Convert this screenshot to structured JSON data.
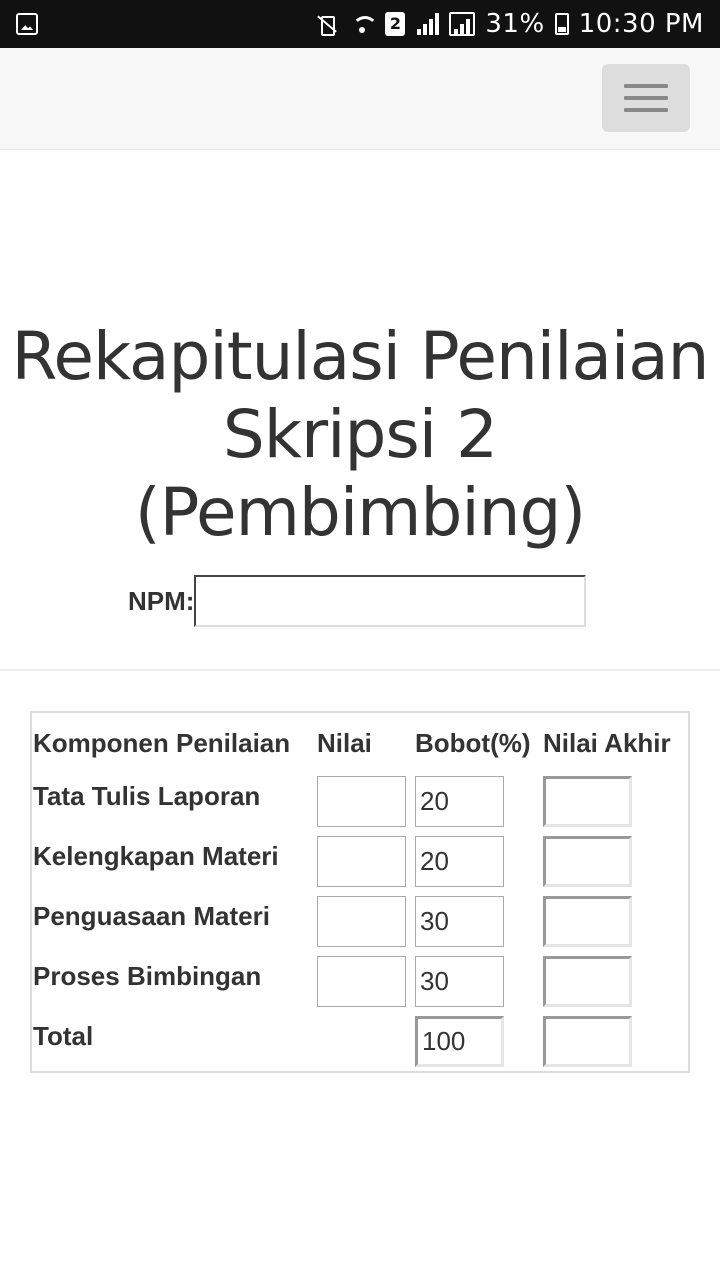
{
  "status_bar": {
    "sim_badge": "2",
    "battery": "31%",
    "time": "10:30 PM",
    "icons": [
      "image-icon",
      "mute-icon",
      "wifi-icon",
      "signal-icon",
      "battery-icon"
    ]
  },
  "page": {
    "heading_line1": "Rekapitulasi Penilaian",
    "heading_line2": "Skripsi 2",
    "heading_line3": "(Pembimbing)",
    "npm_label": "NPM:",
    "npm_value": ""
  },
  "table": {
    "headers": [
      "Komponen Penilaian",
      "Nilai",
      "Bobot(%)",
      "Nilai Akhir"
    ],
    "rows": [
      {
        "label": "Tata Tulis Laporan",
        "nilai": "",
        "bobot": "20",
        "nilai_akhir": ""
      },
      {
        "label": "Kelengkapan Materi",
        "nilai": "",
        "bobot": "20",
        "nilai_akhir": ""
      },
      {
        "label": "Penguasaan Materi",
        "nilai": "",
        "bobot": "30",
        "nilai_akhir": ""
      },
      {
        "label": "Proses Bimbingan",
        "nilai": "",
        "bobot": "30",
        "nilai_akhir": ""
      }
    ],
    "total": {
      "label": "Total",
      "bobot": "100",
      "nilai_akhir": ""
    }
  },
  "colors": {
    "status_bar_bg": "#111111",
    "navbar_bg": "#f8f8f8",
    "toggle_bg": "#dddddd",
    "text": "#333333"
  }
}
